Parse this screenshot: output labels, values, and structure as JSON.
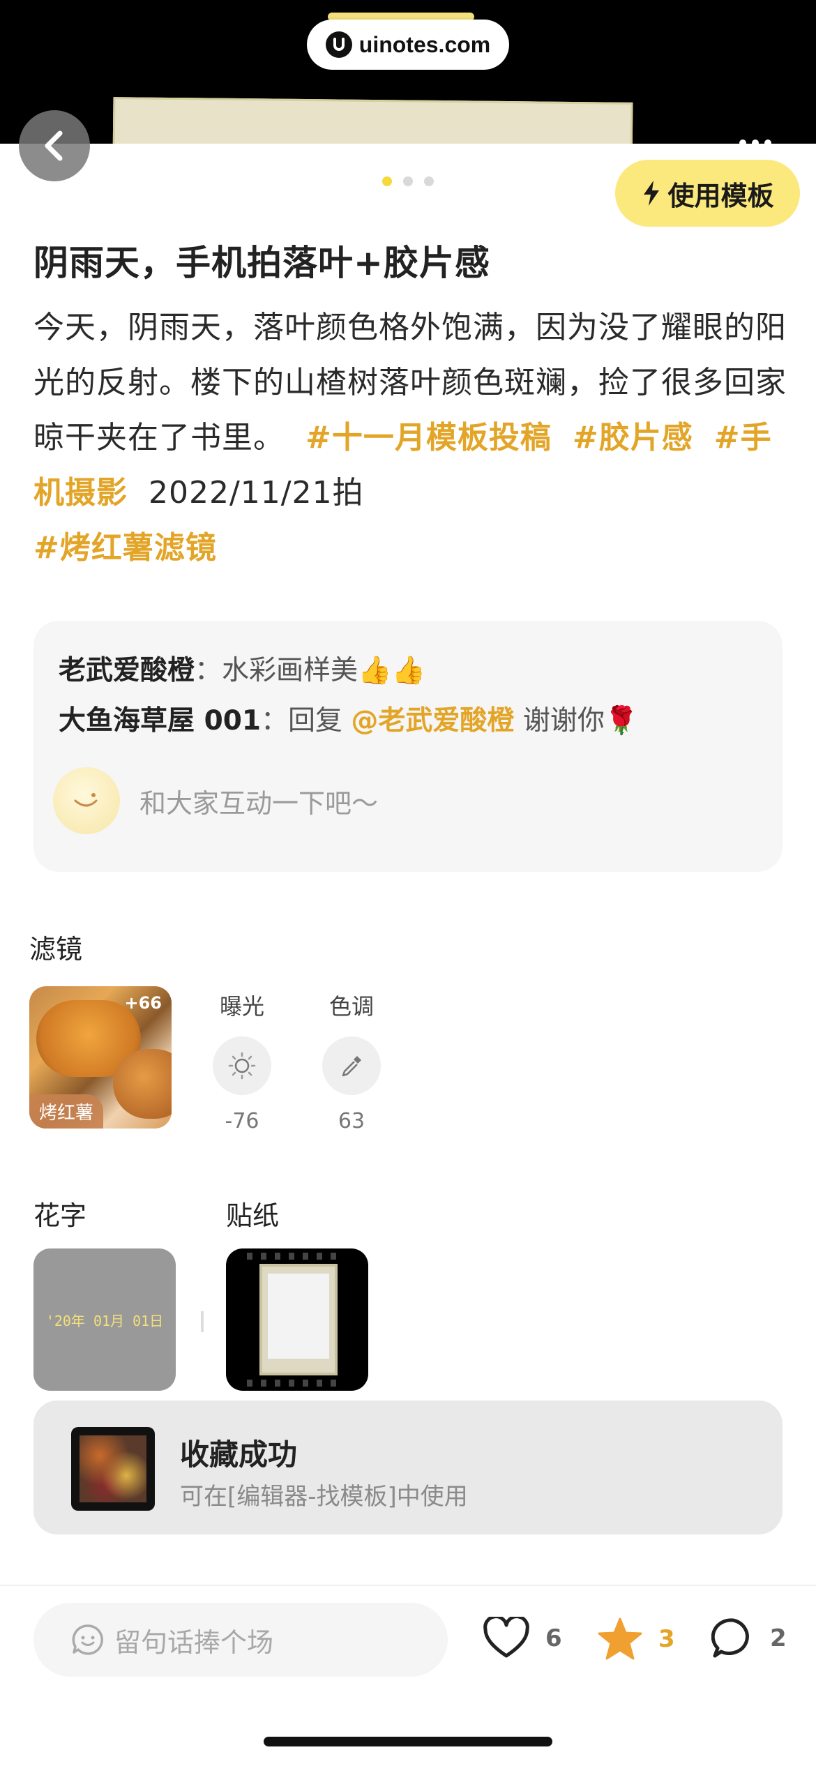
{
  "watermark": {
    "text": "uinotes.com"
  },
  "header": {
    "use_template_label": "使用模板"
  },
  "post": {
    "title": "阴雨天，手机拍落叶+胶片感",
    "body": "今天，阴雨天，落叶颜色格外饱满，因为没了耀眼的阳光的反射。楼下的山楂树落叶颜色斑斓，捡了很多回家晾干夹在了书里。",
    "tags": [
      "#十一月模板投稿",
      "#胶片感",
      "#手机摄影"
    ],
    "date_text": "2022/11/21拍",
    "tag_last": "#烤红薯滤镜"
  },
  "comments": {
    "items": [
      {
        "author": "老武爱酸橙",
        "sep": "：",
        "text": "水彩画样美👍👍"
      },
      {
        "author": "大鱼海草屋 001",
        "sep": "：",
        "reply_prefix": "回复 ",
        "mention": "@老武爱酸橙",
        "text": " 谢谢你🌹"
      }
    ],
    "input_placeholder": "和大家互动一下吧～"
  },
  "filter": {
    "section_label": "滤镜",
    "name": "烤红薯",
    "more_badge": "+66",
    "adjustments": [
      {
        "label": "曝光",
        "value": "-76",
        "icon": "sun-icon"
      },
      {
        "label": "色调",
        "value": "63",
        "icon": "eyedropper-icon"
      }
    ]
  },
  "huazi": {
    "section_label": "花字",
    "sample_text": "'20年 01月 01日"
  },
  "tiezhi": {
    "section_label": "贴纸"
  },
  "toast": {
    "title": "收藏成功",
    "subtitle": "可在[编辑器-找模板]中使用"
  },
  "bottom_bar": {
    "comment_placeholder": "留句话捧个场",
    "likes": "6",
    "favorites": "3",
    "comments": "2"
  },
  "colors": {
    "accent": "#e3a528",
    "template_button": "#fbe97d",
    "pager_active": "#f6d93a"
  }
}
